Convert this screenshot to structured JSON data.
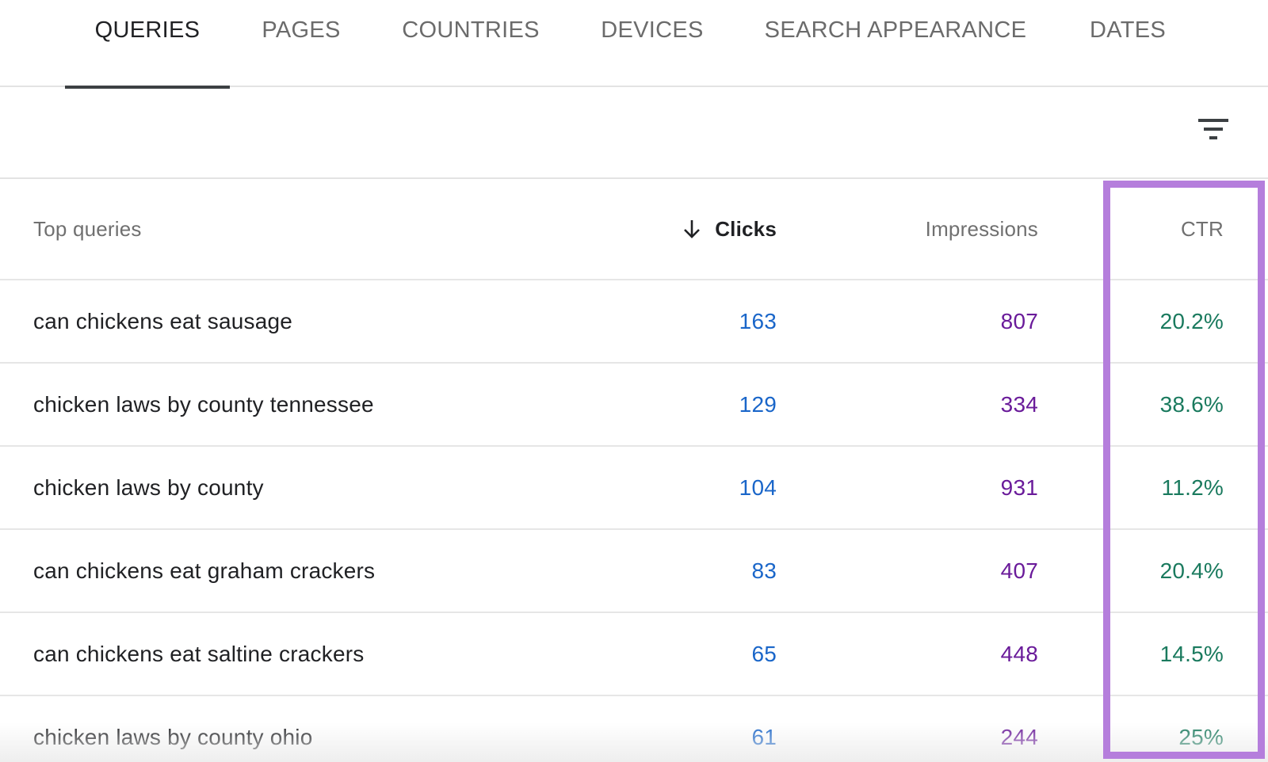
{
  "tabs": [
    {
      "label": "QUERIES",
      "active": true
    },
    {
      "label": "PAGES",
      "active": false
    },
    {
      "label": "COUNTRIES",
      "active": false
    },
    {
      "label": "DEVICES",
      "active": false
    },
    {
      "label": "SEARCH APPEARANCE",
      "active": false
    },
    {
      "label": "DATES",
      "active": false
    }
  ],
  "toolbar": {
    "filter_icon": "filter-list-icon"
  },
  "table": {
    "headers": {
      "query": "Top queries",
      "clicks": "Clicks",
      "impressions": "Impressions",
      "ctr": "CTR"
    },
    "sort": {
      "column": "clicks",
      "direction": "descending",
      "icon": "arrow-down-icon"
    },
    "rows": [
      {
        "query": "can chickens eat sausage",
        "clicks": "163",
        "impressions": "807",
        "ctr": "20.2%"
      },
      {
        "query": "chicken laws by county tennessee",
        "clicks": "129",
        "impressions": "334",
        "ctr": "38.6%"
      },
      {
        "query": "chicken laws by county",
        "clicks": "104",
        "impressions": "931",
        "ctr": "11.2%"
      },
      {
        "query": "can chickens eat graham crackers",
        "clicks": "83",
        "impressions": "407",
        "ctr": "20.4%"
      },
      {
        "query": "can chickens eat saltine crackers",
        "clicks": "65",
        "impressions": "448",
        "ctr": "14.5%"
      },
      {
        "query": "chicken laws by county ohio",
        "clicks": "61",
        "impressions": "244",
        "ctr": "25%"
      }
    ]
  },
  "colors": {
    "clicks": "#1a66c9",
    "impressions": "#6a1b9a",
    "ctr": "#1a7a5e",
    "highlight": "#b57edc",
    "active_tab_indicator": "#3c4043"
  }
}
